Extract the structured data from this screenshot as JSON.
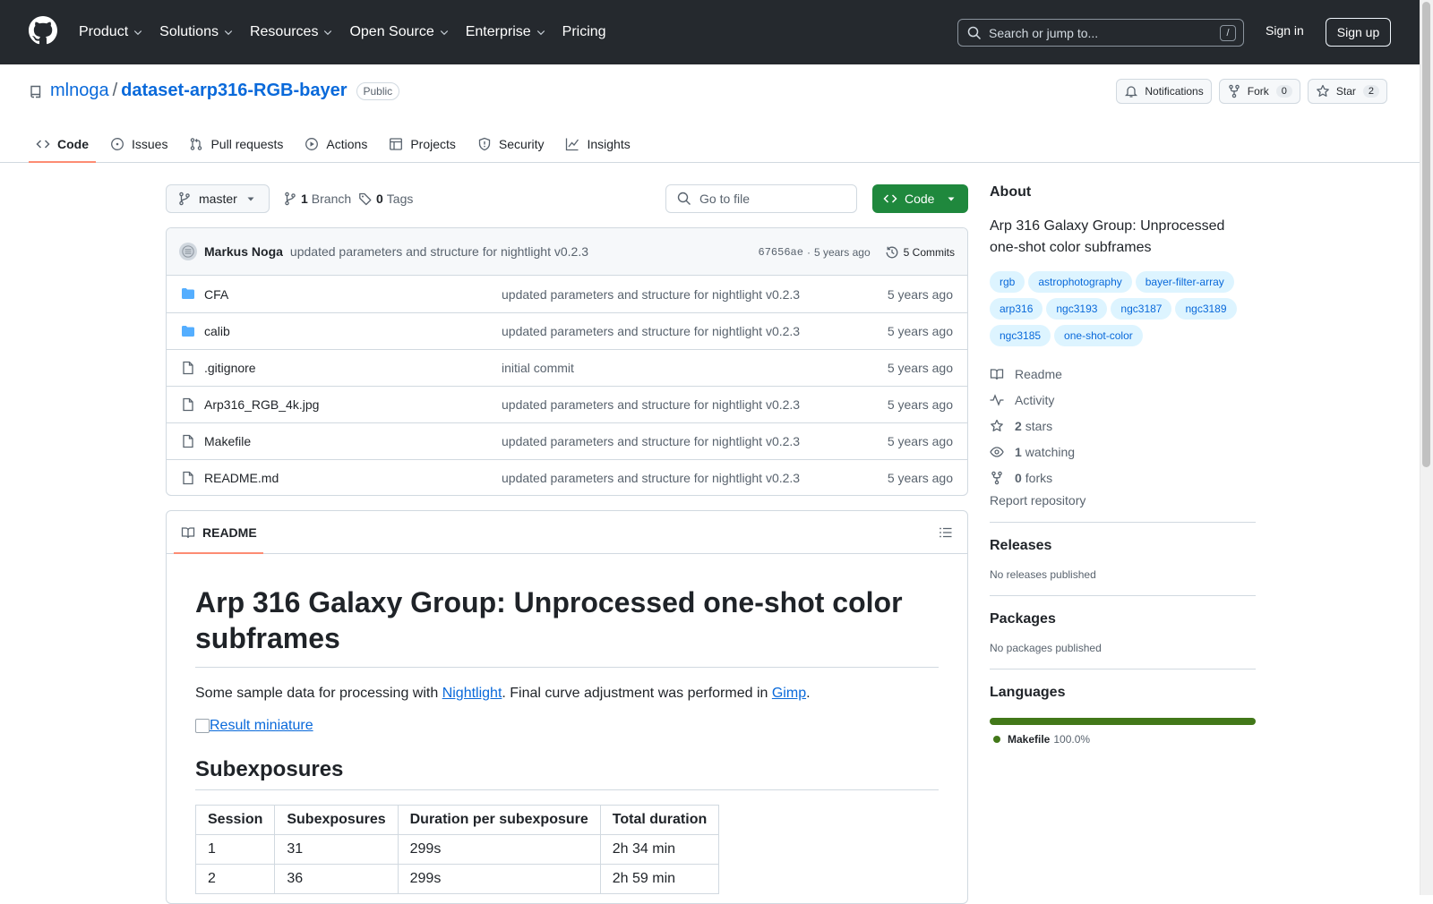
{
  "topbar": {
    "nav": [
      {
        "label": "Product",
        "dropdown": true
      },
      {
        "label": "Solutions",
        "dropdown": true
      },
      {
        "label": "Resources",
        "dropdown": true
      },
      {
        "label": "Open Source",
        "dropdown": true
      },
      {
        "label": "Enterprise",
        "dropdown": true
      },
      {
        "label": "Pricing",
        "dropdown": false
      }
    ],
    "search_placeholder": "Search or jump to...",
    "search_key": "/",
    "signin": "Sign in",
    "signup": "Sign up"
  },
  "repo": {
    "owner": "mlnoga",
    "separator": "/",
    "name": "dataset-arp316-RGB-bayer",
    "visibility": "Public",
    "notifications_label": "Notifications",
    "fork_label": "Fork",
    "fork_count": "0",
    "star_label": "Star",
    "star_count": "2",
    "tabs": [
      {
        "label": "Code",
        "icon": "code-icon",
        "active": true
      },
      {
        "label": "Issues",
        "icon": "issue-icon",
        "active": false
      },
      {
        "label": "Pull requests",
        "icon": "pull-request-icon",
        "active": false
      },
      {
        "label": "Actions",
        "icon": "play-icon",
        "active": false
      },
      {
        "label": "Projects",
        "icon": "table-icon",
        "active": false
      },
      {
        "label": "Security",
        "icon": "shield-icon",
        "active": false
      },
      {
        "label": "Insights",
        "icon": "graph-icon",
        "active": false
      }
    ]
  },
  "toolbar": {
    "branch": "master",
    "branch_count": "1",
    "branch_label": "Branch",
    "tag_count": "0",
    "tag_label": "Tags",
    "goto_placeholder": "Go to file",
    "code_label": "Code"
  },
  "commit": {
    "author": "Markus Noga",
    "message": "updated parameters and structure for nightlight v0.2.3",
    "sha": "67656ae",
    "dot": "·",
    "age": "5 years ago",
    "commits_label": "5 Commits"
  },
  "files": [
    {
      "type": "folder",
      "name": "CFA",
      "message": "updated parameters and structure for nightlight v0.2.3",
      "age": "5 years ago"
    },
    {
      "type": "folder",
      "name": "calib",
      "message": "updated parameters and structure for nightlight v0.2.3",
      "age": "5 years ago"
    },
    {
      "type": "file",
      "name": ".gitignore",
      "message": "initial commit",
      "age": "5 years ago"
    },
    {
      "type": "file",
      "name": "Arp316_RGB_4k.jpg",
      "message": "updated parameters and structure for nightlight v0.2.3",
      "age": "5 years ago"
    },
    {
      "type": "file",
      "name": "Makefile",
      "message": "updated parameters and structure for nightlight v0.2.3",
      "age": "5 years ago"
    },
    {
      "type": "file",
      "name": "README.md",
      "message": "updated parameters and structure for nightlight v0.2.3",
      "age": "5 years ago"
    }
  ],
  "readme": {
    "tab_label": "README",
    "h1": "Arp 316 Galaxy Group: Unprocessed one-shot color subframes",
    "p_before": "Some sample data for processing with ",
    "link1": "Nightlight",
    "p_middle": ". Final curve adjustment was performed in ",
    "link2": "Gimp",
    "p_after": ".",
    "image_alt": "Result miniature",
    "h2": "Subexposures",
    "table": {
      "headers": [
        "Session",
        "Subexposures",
        "Duration per subexposure",
        "Total duration"
      ],
      "rows": [
        [
          "1",
          "31",
          "299s",
          "2h 34 min"
        ],
        [
          "2",
          "36",
          "299s",
          "2h 59 min"
        ]
      ]
    }
  },
  "sidebar": {
    "about_title": "About",
    "description": "Arp 316 Galaxy Group: Unprocessed one-shot color subframes",
    "topics": [
      "rgb",
      "astrophotography",
      "bayer-filter-array",
      "arp316",
      "ngc3193",
      "ngc3187",
      "ngc3189",
      "ngc3185",
      "one-shot-color"
    ],
    "readme_label": "Readme",
    "activity_label": "Activity",
    "stars_count": "2",
    "stars_label": "stars",
    "watching_count": "1",
    "watching_label": "watching",
    "forks_count": "0",
    "forks_label": "forks",
    "report_label": "Report repository",
    "releases_title": "Releases",
    "releases_text": "No releases published",
    "packages_title": "Packages",
    "packages_text": "No packages published",
    "languages_title": "Languages",
    "languages": [
      {
        "name": "Makefile",
        "percent": "100.0%",
        "color": "#427819"
      }
    ]
  }
}
